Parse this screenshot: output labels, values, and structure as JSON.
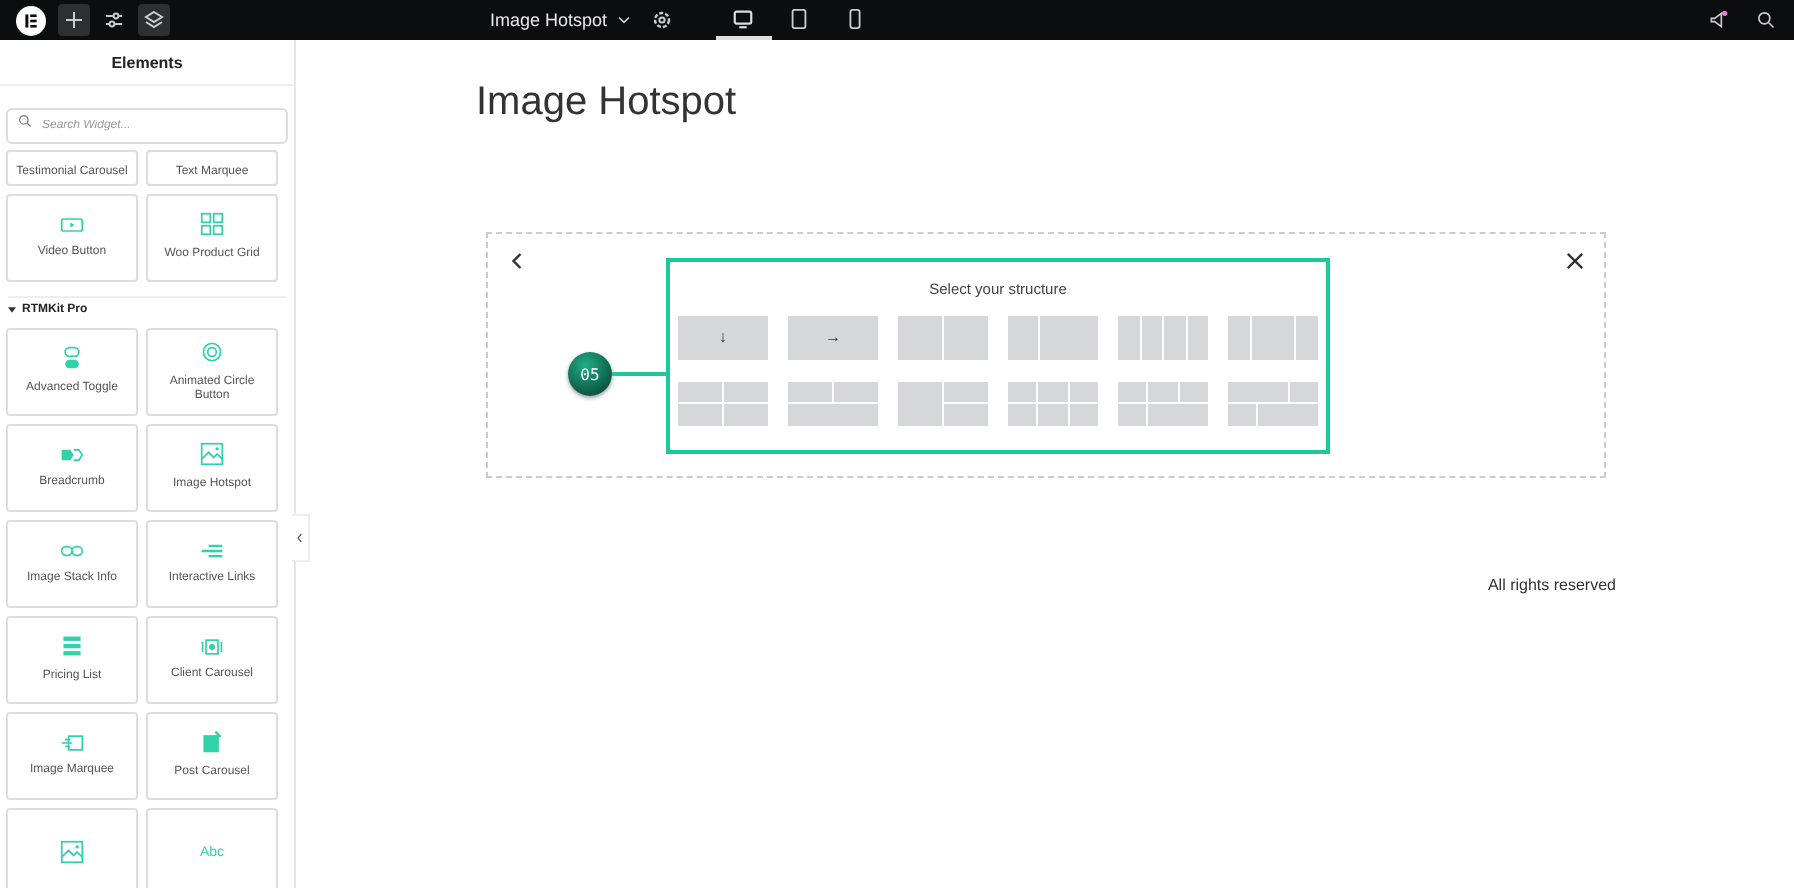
{
  "topbar": {
    "page_title": "Image Hotspot",
    "devices": [
      {
        "kind": "desktop",
        "selected": true
      },
      {
        "kind": "tablet",
        "selected": false
      },
      {
        "kind": "mobile",
        "selected": false
      }
    ],
    "notification": true
  },
  "sidebar": {
    "title": "Elements",
    "search": {
      "placeholder": "Search Widget..."
    },
    "top_widgets": [
      {
        "label": "Testimonial Carousel",
        "kind": "none"
      },
      {
        "label": "Text Marquee",
        "kind": "none"
      },
      {
        "label": "Video Button",
        "kind": "video"
      },
      {
        "label": "Woo Product Grid",
        "kind": "grid"
      }
    ],
    "category": {
      "label": "RTMKit Pro",
      "expanded": true
    },
    "widgets": [
      {
        "label": "Advanced Toggle",
        "kind": "toggle"
      },
      {
        "label": "Animated Circle Button",
        "kind": "circle"
      },
      {
        "label": "Breadcrumb",
        "kind": "crumb"
      },
      {
        "label": "Image Hotspot",
        "kind": "image"
      },
      {
        "label": "Image Stack Info",
        "kind": "stack"
      },
      {
        "label": "Interactive Links",
        "kind": "links"
      },
      {
        "label": "Pricing List",
        "kind": "list"
      },
      {
        "label": "Client Carousel",
        "kind": "carousel"
      },
      {
        "label": "Image Marquee",
        "kind": "marquee"
      },
      {
        "label": "Post Carousel",
        "kind": "post"
      },
      {
        "kind": "image"
      },
      {
        "kind": "text"
      }
    ],
    "text_icon": "Abc"
  },
  "canvas": {
    "heading": "Image Hotspot",
    "hotspot": "05",
    "structure": {
      "title": "Select your structure",
      "presets": [
        {
          "kind": "single",
          "glyph": "↓"
        },
        {
          "kind": "single",
          "glyph": "→"
        },
        {
          "kind": "halves"
        },
        {
          "kind": "third-twothirds"
        },
        {
          "kind": "quarters"
        },
        {
          "kind": "quarter-half-quarter"
        },
        {
          "kind": "grid2x2"
        },
        {
          "kind": "two-over-one"
        },
        {
          "kind": "one-beside-two"
        },
        {
          "kind": "grid3x2"
        },
        {
          "kind": "three-over-two"
        },
        {
          "kind": "mixed"
        }
      ]
    }
  },
  "footer": "All rights reserved"
}
